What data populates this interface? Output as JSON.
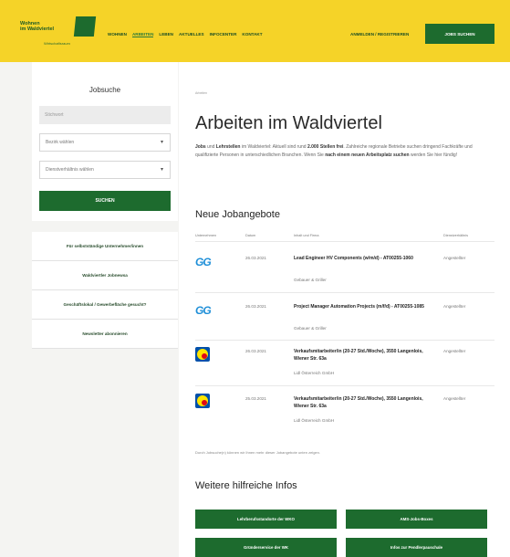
{
  "header": {
    "logo_line1": "Wohnen",
    "logo_line2": "im Waldviertel",
    "logo_sub": "Wirtschaftsraum",
    "nav": [
      "Wohnen",
      "Arbeiten",
      "Leben",
      "Aktuelles",
      "Infocenter",
      "Kontakt"
    ],
    "login": "Anmelden / Registrieren",
    "register": "Jobs suchen"
  },
  "sidebar": {
    "title": "Jobsuche",
    "search_placeholder": "Stichwort",
    "select1": "Bezirk wählen",
    "select2": "Dienstverhältnis wählen",
    "search_button": "Suchen",
    "links": [
      "Für selbstständige Unternehmer/innen",
      "Waldviertler Jobnewsa",
      "Geschäftslokal / Gewerbefläche gesucht?",
      "Newsletter abonnieren"
    ]
  },
  "main": {
    "breadcrumb": "Arbeiten",
    "title": "Arbeiten im Waldviertel",
    "intro_a": "Jobs",
    "intro_b": " und ",
    "intro_c": "Lehrstellen",
    "intro_d": " im Waldviertel: Aktuell sind rund ",
    "intro_e": "2.000 Stellen frei",
    "intro_f": ". Zahlreiche regionale Betriebe suchen dringend Fachkräfte und qualifizierte Personen in unterschiedlichen Branchen. Wenn Sie ",
    "intro_g": "nach einem neuen Arbeitsplatz suchen",
    "intro_h": " werden Sie hier fündig!",
    "jobs_title": "Neue Jobangebote",
    "columns": [
      "Unternehmen",
      "Datum",
      "Inhalt und Firma",
      "Dienstverhältnis"
    ],
    "jobs": [
      {
        "logo": "GG",
        "date": "26.03.2021",
        "title": "Lead Engineer HV Components (w/m/d) - AT00255-1060",
        "company": "Gebauer & Griller",
        "type": "Angestellter"
      },
      {
        "logo": "GG",
        "date": "26.03.2021",
        "title": "Project Manager Automation Projects (m/f/d) - AT00255-1085",
        "company": "Gebauer & Griller",
        "type": "Angestellter"
      },
      {
        "logo": "LIDL",
        "date": "26.03.2021",
        "title": "Verkaufsmitarbeiter/in (20-27 Std./Woche), 3550 Langenlois, Wiener Str. 63a",
        "company": "Lidl Österreich GmbH",
        "type": "Angestellter"
      },
      {
        "logo": "LIDL",
        "date": "25.03.2021",
        "title": "Verkaufsmitarbeiter/in (20-27 Std./Woche), 3550 Langenlois, Wiener Str. 63a",
        "company": "Lidl Österreich GmbH",
        "type": "Angestellter"
      }
    ],
    "footnote": "Durch Jobsuche(n) können wir Ihnen mehr dieser Jobangebote unten zeigen.",
    "info_title": "Weitere hilfreiche Infos",
    "info_buttons": [
      "Lehrberufsstandorte der WKO",
      "AMS-Jobs-Boxes",
      "Gründerservice der WK",
      "Infos zur Pendlerpauschale"
    ]
  },
  "colors": {
    "accent_yellow": "#f5d328",
    "brand_green": "#1d6b2e",
    "gg_blue": "#1f8fd8",
    "lidl_blue": "#0050aa"
  }
}
